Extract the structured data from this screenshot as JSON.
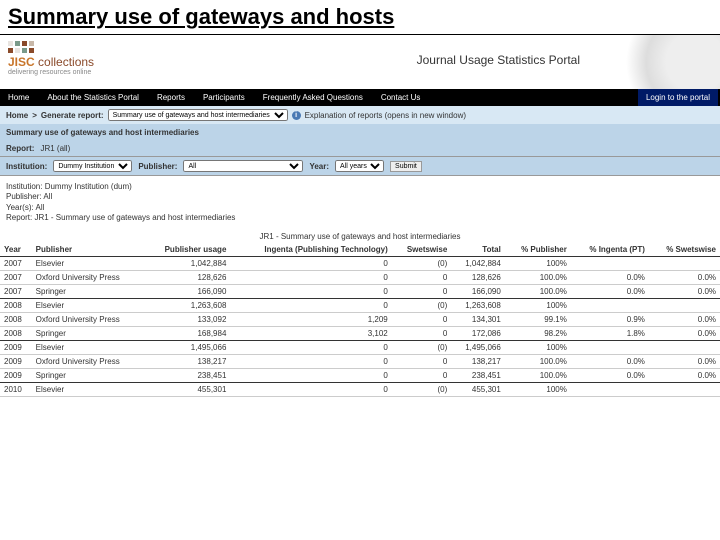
{
  "slide_title": "Summary use of gateways and hosts",
  "logo": {
    "brand": "JISC",
    "sub": "collections",
    "tagline": "delivering resources online"
  },
  "portal_title": "Journal Usage Statistics Portal",
  "nav": {
    "items": [
      "Home",
      "About the Statistics Portal",
      "Reports",
      "Participants",
      "Frequently Asked Questions",
      "Contact Us"
    ],
    "login": "Login to the portal"
  },
  "breadcrumb": {
    "home": "Home",
    "sep": ">",
    "generate": "Generate report:",
    "selected_report": "Summary use of gateways and host intermediaries",
    "explain": "Explanation of reports (opens in new window)"
  },
  "report_header": "Summary use of gateways and host intermediaries",
  "filters": {
    "report_label": "Report:",
    "report_value": "JR1 (all)",
    "inst_label": "Institution:",
    "inst_value": "Dummy Institution",
    "pub_label": "Publisher:",
    "pub_value": "All",
    "year_label": "Year:",
    "year_value": "All years",
    "submit": "Submit"
  },
  "meta": {
    "institution": "Institution: Dummy Institution (dum)",
    "publisher": "Publisher: All",
    "years": "Year(s): All",
    "report": "Report: JR1 - Summary use of gateways and host intermediaries"
  },
  "table": {
    "title": "JR1 - Summary use of gateways and host intermediaries",
    "columns": [
      "Year",
      "Publisher",
      "Publisher usage",
      "Ingenta (Publishing Technology)",
      "Swetswise",
      "Total",
      "% Publisher",
      "% Ingenta (PT)",
      "% Swetswise"
    ],
    "rows": [
      {
        "group_end": false,
        "year": "2007",
        "publisher": "Elsevier",
        "pub_usage": "1,042,884",
        "ingenta": "0",
        "swets": "(0)",
        "total": "1,042,884",
        "pct_pub": "100%",
        "pct_ing": "",
        "pct_sw": ""
      },
      {
        "group_end": false,
        "year": "2007",
        "publisher": "Oxford University Press",
        "pub_usage": "128,626",
        "ingenta": "0",
        "swets": "0",
        "total": "128,626",
        "pct_pub": "100.0%",
        "pct_ing": "0.0%",
        "pct_sw": "0.0%"
      },
      {
        "group_end": true,
        "year": "2007",
        "publisher": "Springer",
        "pub_usage": "166,090",
        "ingenta": "0",
        "swets": "0",
        "total": "166,090",
        "pct_pub": "100.0%",
        "pct_ing": "0.0%",
        "pct_sw": "0.0%"
      },
      {
        "group_end": false,
        "year": "2008",
        "publisher": "Elsevier",
        "pub_usage": "1,263,608",
        "ingenta": "0",
        "swets": "(0)",
        "total": "1,263,608",
        "pct_pub": "100%",
        "pct_ing": "",
        "pct_sw": ""
      },
      {
        "group_end": false,
        "year": "2008",
        "publisher": "Oxford University Press",
        "pub_usage": "133,092",
        "ingenta": "1,209",
        "swets": "0",
        "total": "134,301",
        "pct_pub": "99.1%",
        "pct_ing": "0.9%",
        "pct_sw": "0.0%"
      },
      {
        "group_end": true,
        "year": "2008",
        "publisher": "Springer",
        "pub_usage": "168,984",
        "ingenta": "3,102",
        "swets": "0",
        "total": "172,086",
        "pct_pub": "98.2%",
        "pct_ing": "1.8%",
        "pct_sw": "0.0%"
      },
      {
        "group_end": false,
        "year": "2009",
        "publisher": "Elsevier",
        "pub_usage": "1,495,066",
        "ingenta": "0",
        "swets": "(0)",
        "total": "1,495,066",
        "pct_pub": "100%",
        "pct_ing": "",
        "pct_sw": ""
      },
      {
        "group_end": false,
        "year": "2009",
        "publisher": "Oxford University Press",
        "pub_usage": "138,217",
        "ingenta": "0",
        "swets": "0",
        "total": "138,217",
        "pct_pub": "100.0%",
        "pct_ing": "0.0%",
        "pct_sw": "0.0%"
      },
      {
        "group_end": true,
        "year": "2009",
        "publisher": "Springer",
        "pub_usage": "238,451",
        "ingenta": "0",
        "swets": "0",
        "total": "238,451",
        "pct_pub": "100.0%",
        "pct_ing": "0.0%",
        "pct_sw": "0.0%"
      },
      {
        "group_end": false,
        "year": "2010",
        "publisher": "Elsevier",
        "pub_usage": "455,301",
        "ingenta": "0",
        "swets": "(0)",
        "total": "455,301",
        "pct_pub": "100%",
        "pct_ing": "",
        "pct_sw": ""
      }
    ]
  }
}
